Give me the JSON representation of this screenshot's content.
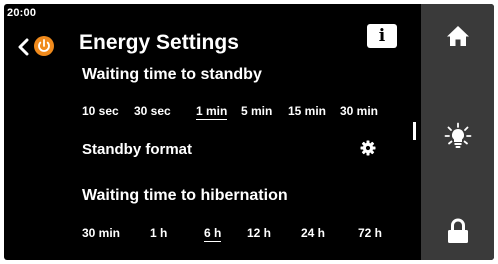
{
  "status": {
    "time": "20:00"
  },
  "header": {
    "title": "Energy Settings",
    "info_label": "i",
    "back_icon": "chevron-left-icon",
    "power_icon": "power-icon",
    "accent_color": "#f08a1c"
  },
  "standby": {
    "heading": "Waiting time to standby",
    "options": [
      "10 sec",
      "30 sec",
      "1 min",
      "5 min",
      "15 min",
      "30 min"
    ],
    "selected": "1 min"
  },
  "standby_format": {
    "label": "Standby format",
    "icon": "gear-icon"
  },
  "hibernation": {
    "heading": "Waiting time to hibernation",
    "options": [
      "30 min",
      "1 h",
      "6 h",
      "12 h",
      "24 h",
      "72 h"
    ],
    "selected": "6 h"
  },
  "nav": {
    "items": [
      {
        "icon": "home-icon"
      },
      {
        "icon": "light-bulb-icon"
      },
      {
        "icon": "lock-icon"
      }
    ],
    "background": "#3a3a3a"
  }
}
